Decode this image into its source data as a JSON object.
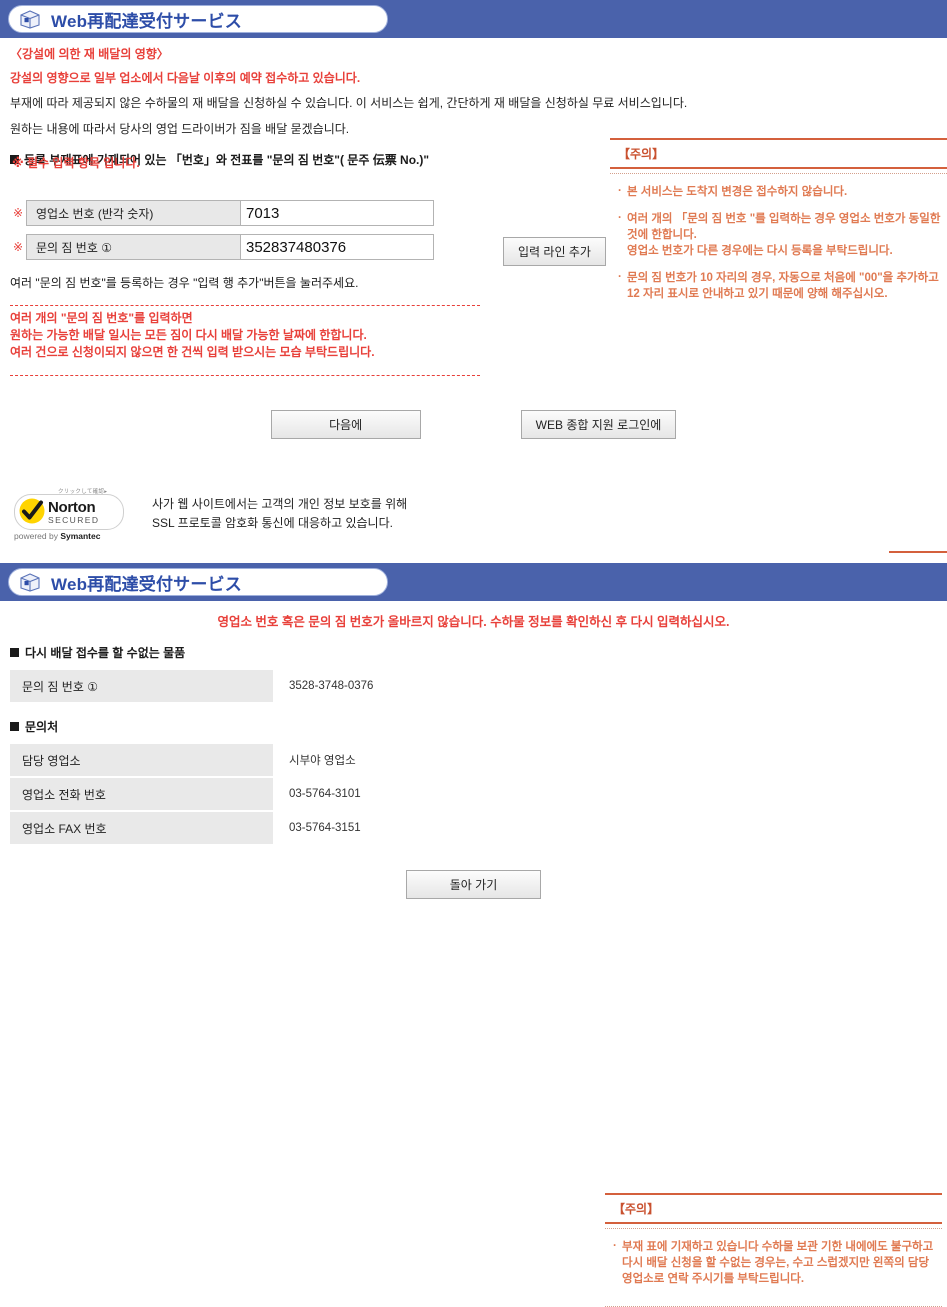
{
  "panel1": {
    "header": {
      "title": "Web再配達受付サービス",
      "icon": "package-box-icon"
    },
    "intro": {
      "heading": "〈강설에 의한 재 배달의 영향〉",
      "heading2": "강설의 영향으로 일부 업소에서 다음날 이후의 예약 접수하고 있습니다.",
      "body_line1": "부재에 따라 제공되지 않은 수하물의 재 배달을 신청하실 수 있습니다. 이 서비스는 쉽게, 간단하게 재 배달을 신청하실 무료 서비스입니다.",
      "body_line2": "원하는 내용에 따라서 당사의 영업 드라이버가 짐을 배달 묻겠습니다."
    },
    "overlap_heading": {
      "layer_black": "등록 부재표에 기재되어 있는 「번호」와 전표를 \"문의 짐 번호\"( 문주 伝票 No.)\"",
      "layer_red": "※ 필수 입력 항목 입니다."
    },
    "form": {
      "rows": [
        {
          "required_mark": "※",
          "label": "영업소 번호 (반각 숫자)",
          "value": "7013"
        },
        {
          "required_mark": "※",
          "label": "문의 짐 번호 ①",
          "value": "352837480376"
        }
      ],
      "add_line_button": "입력 라인 추가",
      "hint": "여러 \"문의 짐 번호\"를 등록하는 경우 \"입력 행 추가\"버튼을 눌러주세요.",
      "warn_line1": "여러 개의 \"문의 짐 번호\"를 입력하면",
      "warn_line2": "원하는 가능한 배달 일시는 모든 짐이 다시 배달 가능한 날짜에 한합니다.",
      "warn_line3": "여러 건으로 신청이되지 않으면 한 건씩 입력 받으시는 모습 부탁드립니다."
    },
    "notice": {
      "title": "【주의】",
      "items": [
        "본 서비스는 도착지 변경은 접수하지 않습니다.",
        "여러 개의 「문의 짐 번호 \"를 입력하는 경우 영업소 번호가 동일한 것에 한합니다.\n영업소 번호가 다른 경우에는 다시 등록을 부탁드립니다.",
        "문의 짐 번호가 10 자리의 경우, 자동으로 처음에 \"00\"을 추가하고 12 자리 표시로 안내하고 있기 때문에 양해 해주십시오."
      ]
    },
    "buttons": {
      "next": "다음에",
      "web_login": "WEB 종합 지원 로그인에"
    },
    "norton": {
      "caption_top": "クリックして確認▸",
      "brand": "Norton",
      "secured": "SECURED",
      "powered_prefix": "powered by ",
      "powered_brand": "Symantec",
      "check_icon": "checkmark-icon",
      "text_line1": "사가 웹 사이트에서는 고객의 개인 정보 보호를 위해",
      "text_line2": "SSL 프로토콜 암호화 통신에 대응하고 있습니다."
    }
  },
  "panel2": {
    "header": {
      "title": "Web再配達受付サービス",
      "icon": "package-box-icon"
    },
    "error_message": "영업소 번호 혹은 문의 짐 번호가 올바르지 않습니다. 수하물 정보를 확인하신 후 다시 입력하십시오.",
    "section1_title": "다시 배달 접수를 할 수없는 물품",
    "table1": [
      {
        "label": "문의 짐 번호 ①",
        "value": "3528-3748-0376"
      }
    ],
    "section2_title": "문의처",
    "table2": [
      {
        "label": "담당 영업소",
        "value": "시부야 영업소"
      },
      {
        "label": "영업소 전화 번호",
        "value": "03-5764-3101"
      },
      {
        "label": "영업소 FAX 번호",
        "value": "03-5764-3151"
      }
    ],
    "notice": {
      "title": "【주의】",
      "items": [
        "부재 표에 기재하고 있습니다 수하물 보관 기한 내에에도 불구하고 다시 배달 신청을 할 수없는 경우는, 수고 스럽겠지만 왼쪽의 담당 영업소로 연락 주시기를 부탁드립니다."
      ]
    },
    "back_button": "돌아 가기"
  },
  "colors": {
    "header_blue": "#4a62ab",
    "title_blue": "#2d4da8",
    "alert_red": "#e8403a",
    "notice_orange": "#d4603c",
    "field_gray": "#e8e8e8"
  }
}
